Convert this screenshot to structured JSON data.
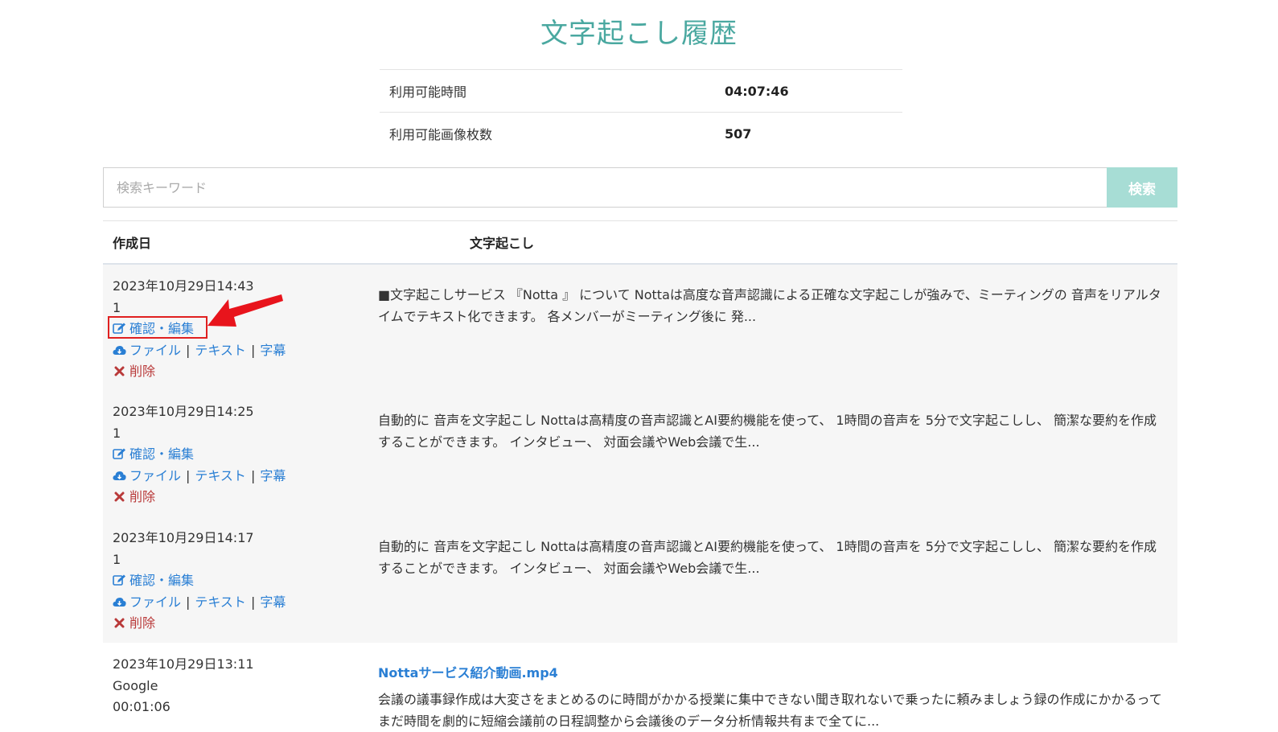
{
  "page": {
    "title": "文字起こし履歴"
  },
  "usage": [
    {
      "label": "利用可能時間",
      "value": "04:07:46"
    },
    {
      "label": "利用可能画像枚数",
      "value": "507"
    }
  ],
  "search": {
    "placeholder": "検索キーワード",
    "button_label": "検索"
  },
  "table": {
    "headers": {
      "created": "作成日",
      "transcript": "文字起こし"
    },
    "actions": {
      "edit": "確認・編集",
      "file": "ファイル",
      "text": "テキスト",
      "subtitle": "字幕",
      "separator": "|",
      "delete": "削除"
    },
    "rows": [
      {
        "date": "2023年10月29日14:43",
        "meta": "1",
        "text": "■文字起こしサービス 『Notta 』 について Nottaは高度な音声認識による正確な文字起こしが強みで、ミーティングの 音声をリアルタイムでテキスト化できます。 各メンバーがミーティング後に 発..."
      },
      {
        "date": "2023年10月29日14:25",
        "meta": "1",
        "text": "自動的に 音声を文字起こし Nottaは高精度の音声認識とAI要約機能を使って、 1時間の音声を 5分で文字起こしし、 簡潔な要約を作成することができます。 インタビュー、 対面会議やWeb会議で生..."
      },
      {
        "date": "2023年10月29日14:17",
        "meta": "1",
        "text": "自動的に 音声を文字起こし Nottaは高精度の音声認識とAI要約機能を使って、 1時間の音声を 5分で文字起こしし、 簡潔な要約を作成することができます。 インタビュー、 対面会議やWeb会議で生..."
      },
      {
        "date": "2023年10月29日13:11",
        "meta": "Google",
        "duration": "00:01:06",
        "title": "Nottaサービス紹介動画.mp4",
        "text": "会議の議事録作成は大変さをまとめるのに時間がかかる授業に集中できない聞き取れないで乗ったに頼みましょう録の作成にかかるってまだ時間を劇的に短縮会議前の日程調整から会議後のデータ分析情報共有まで全てに..."
      }
    ]
  },
  "annotation": {
    "box_color": "#e02020",
    "arrow_color": "#e8141c"
  },
  "colors": {
    "title": "#4aa8a0",
    "link": "#2a7fd4",
    "delete": "#b93a3a",
    "search_button": "#a7ddd5"
  }
}
